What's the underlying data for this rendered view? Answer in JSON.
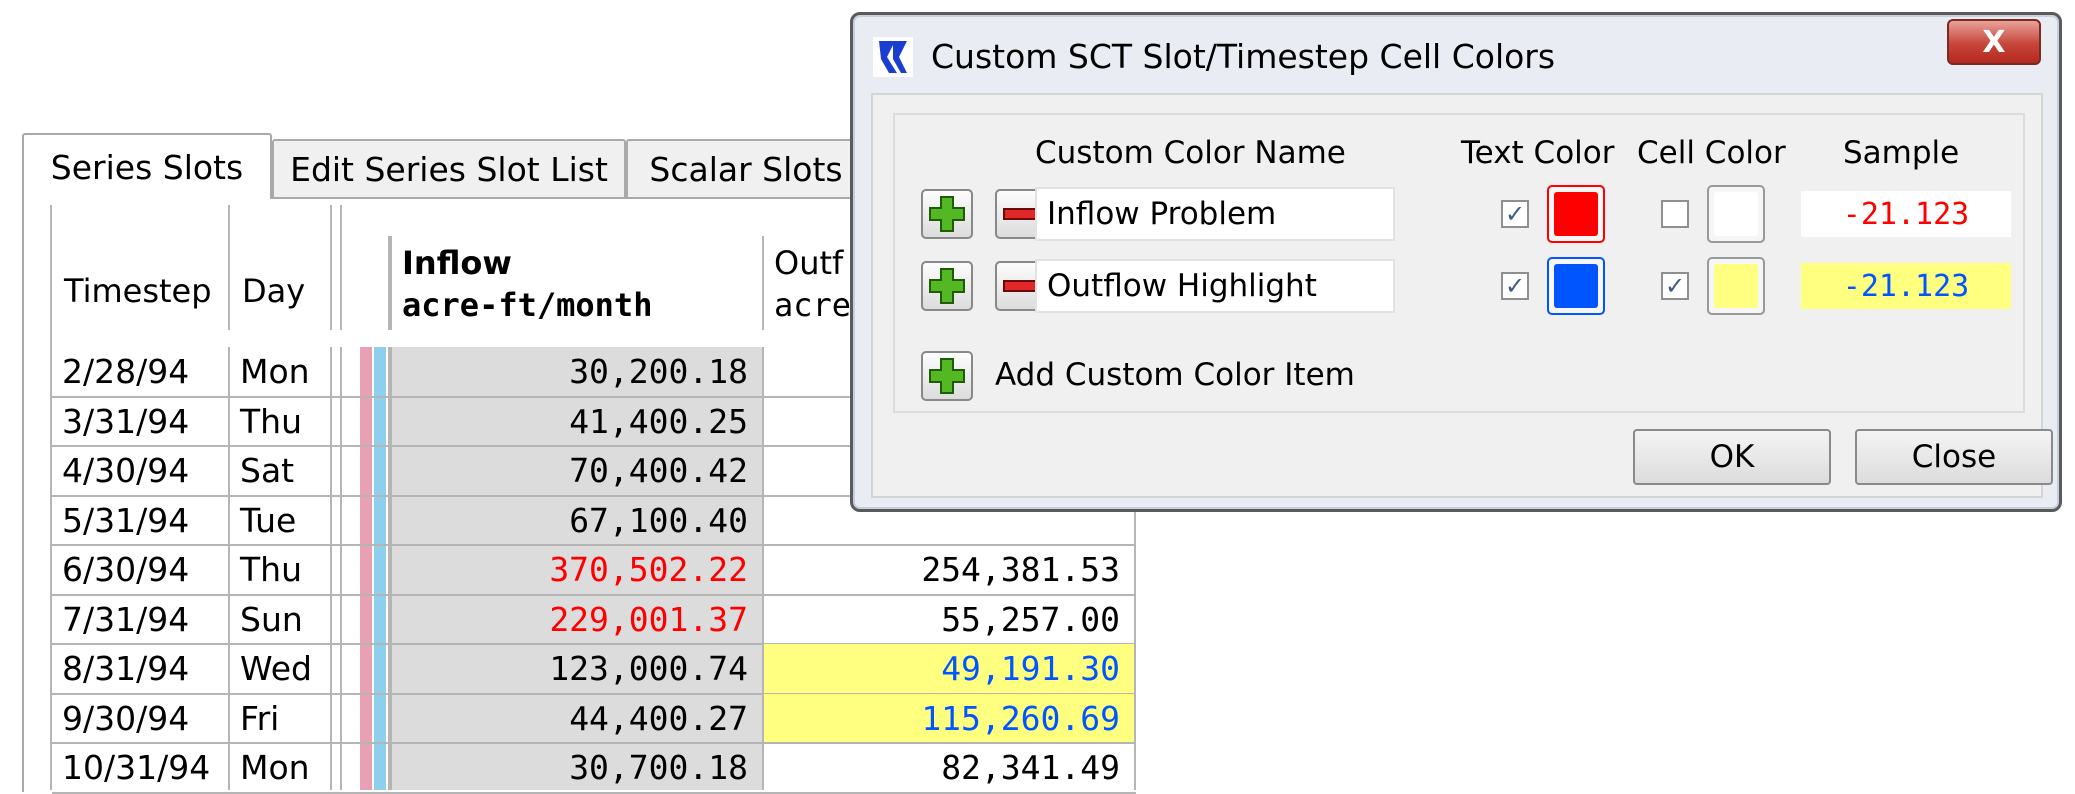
{
  "tabs": [
    {
      "label": "Series Slots"
    },
    {
      "label": "Edit Series Slot List"
    },
    {
      "label": "Scalar Slots"
    }
  ],
  "grid": {
    "headers": {
      "timestep": "Timestep",
      "day": "Day",
      "inflow_name": "Inflow",
      "inflow_unit": "acre-ft/month",
      "outflow_name": "Outf",
      "outflow_unit": "acre-"
    },
    "rows": [
      {
        "date": "2/28/94",
        "day": "Mon",
        "inflow": "30,200.18",
        "outflow": ""
      },
      {
        "date": "3/31/94",
        "day": "Thu",
        "inflow": "41,400.25",
        "outflow": ""
      },
      {
        "date": "4/30/94",
        "day": "Sat",
        "inflow": "70,400.42",
        "outflow": ""
      },
      {
        "date": "5/31/94",
        "day": "Tue",
        "inflow": "67,100.40",
        "outflow": ""
      },
      {
        "date": "6/30/94",
        "day": "Thu",
        "inflow": "370,502.22",
        "outflow": "254,381.53"
      },
      {
        "date": "7/31/94",
        "day": "Sun",
        "inflow": "229,001.37",
        "outflow": "55,257.00"
      },
      {
        "date": "8/31/94",
        "day": "Wed",
        "inflow": "123,000.74",
        "outflow": "49,191.30"
      },
      {
        "date": "9/30/94",
        "day": "Fri",
        "inflow": "44,400.27",
        "outflow": "115,260.69"
      },
      {
        "date": "10/31/94",
        "day": "Mon",
        "inflow": "30,700.18",
        "outflow": "82,341.49"
      }
    ]
  },
  "dialog": {
    "title": "Custom SCT Slot/Timestep Cell Colors",
    "close_glyph": "X",
    "columns": {
      "name": "Custom Color Name",
      "text_color": "Text Color",
      "cell_color": "Cell Color",
      "sample": "Sample"
    },
    "items": [
      {
        "name": "Inflow Problem",
        "text_checked": true,
        "text_color": "#ff0000",
        "cell_checked": false,
        "cell_color": "#ffffff",
        "sample": "-21.123"
      },
      {
        "name": "Outflow Highlight",
        "text_checked": true,
        "text_color": "#0055ff",
        "cell_checked": true,
        "cell_color": "#ffff80",
        "sample": "-21.123"
      }
    ],
    "add_label": "Add Custom Color Item",
    "ok_label": "OK",
    "close_label": "Close"
  },
  "colors": {
    "problem_text": "#ff0000",
    "highlight_text": "#0055ff",
    "highlight_cell": "#ffff80",
    "marker_pink": "#e7a0b4",
    "marker_blue": "#8ecff0",
    "inflow_bg": "#dcdcdc"
  }
}
